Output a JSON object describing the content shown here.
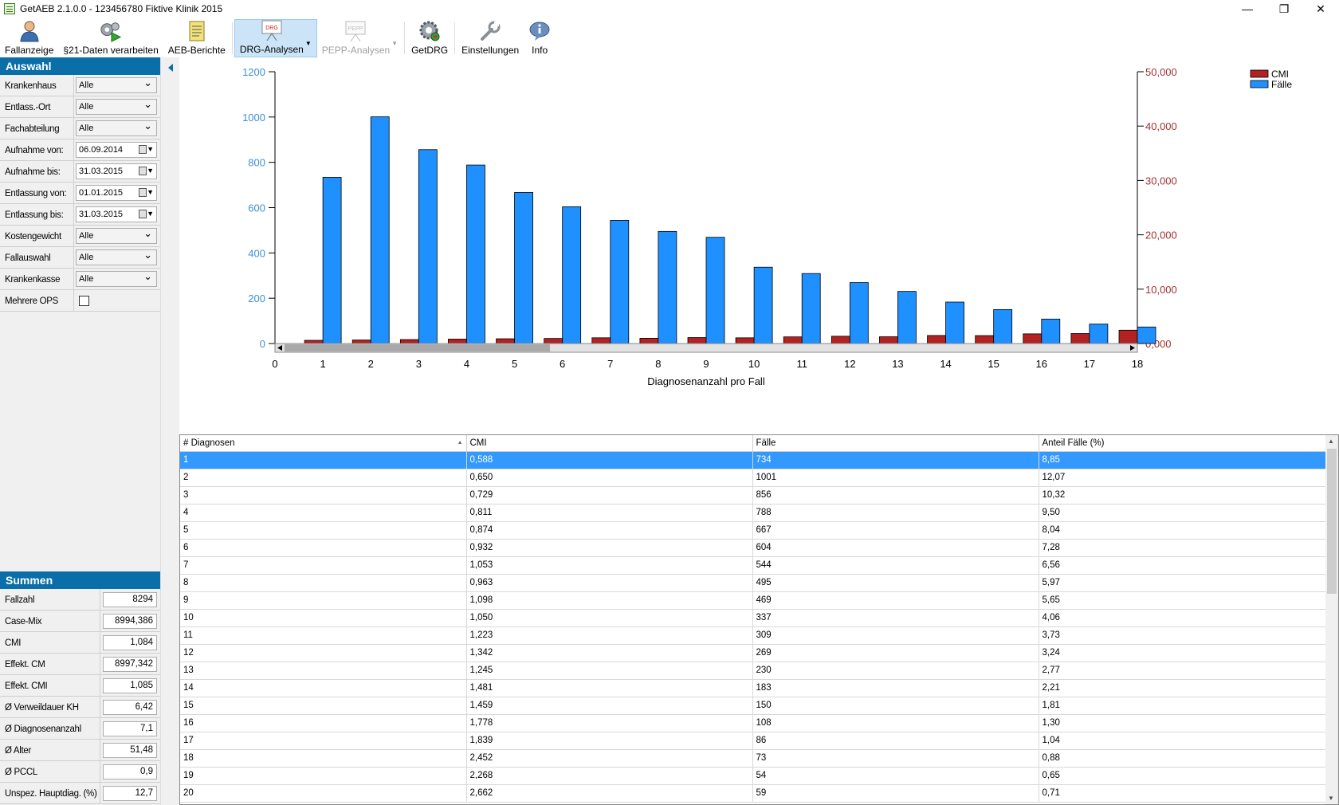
{
  "window": {
    "title": "GetAEB 2.1.0.0 - 123456780 Fiktive Klinik 2015",
    "minimize": "—",
    "restore": "❐",
    "close": "✕"
  },
  "toolbar": {
    "fallanzeige": "Fallanzeige",
    "p21": "§21-Daten verarbeiten",
    "aeb": "AEB-Berichte",
    "drg": "DRG-Analysen",
    "pepp": "PEPP-Analysen",
    "getdrg": "GetDRG",
    "einstellungen": "Einstellungen",
    "info": "Info",
    "drg_icon_text": "DRG",
    "pepp_icon_text": "PEPP"
  },
  "auswahl": {
    "title": "Auswahl",
    "rows": [
      {
        "label": "Krankenhaus",
        "value": "Alle"
      },
      {
        "label": "Entlass.-Ort",
        "value": "Alle"
      },
      {
        "label": "Fachabteilung",
        "value": "Alle"
      },
      {
        "label": "Aufnahme von:",
        "value": "06.09.2014"
      },
      {
        "label": "Aufnahme bis:",
        "value": "31.03.2015"
      },
      {
        "label": "Entlassung von:",
        "value": "01.01.2015"
      },
      {
        "label": "Entlassung bis:",
        "value": "31.03.2015"
      },
      {
        "label": "Kostengewicht",
        "value": "Alle"
      },
      {
        "label": "Fallauswahl",
        "value": "Alle"
      },
      {
        "label": "Krankenkasse",
        "value": "Alle"
      },
      {
        "label": "Mehrere OPS",
        "value": ""
      }
    ]
  },
  "summen": {
    "title": "Summen",
    "rows": [
      {
        "label": "Fallzahl",
        "value": "8294"
      },
      {
        "label": "Case-Mix",
        "value": "8994,386"
      },
      {
        "label": "CMI",
        "value": "1,084"
      },
      {
        "label": "Effekt. CM",
        "value": "8997,342"
      },
      {
        "label": "Effekt. CMI",
        "value": "1,085"
      },
      {
        "label": "Ø Verweildauer KH",
        "value": "6,42"
      },
      {
        "label": "Ø Diagnosenanzahl",
        "value": "7,1"
      },
      {
        "label": "Ø Alter",
        "value": "51,48"
      },
      {
        "label": "Ø PCCL",
        "value": "0,9"
      },
      {
        "label": "Unspez. Hauptdiag. (%)",
        "value": "12,7"
      }
    ]
  },
  "chart_data": {
    "type": "bar",
    "xlabel": "Diagnosenanzahl pro Fall",
    "x_ticks": [
      "0",
      "1",
      "2",
      "3",
      "4",
      "5",
      "6",
      "7",
      "8",
      "9",
      "10",
      "11",
      "12",
      "13",
      "14",
      "15",
      "16",
      "17",
      "18"
    ],
    "categories": [
      1,
      2,
      3,
      4,
      5,
      6,
      7,
      8,
      9,
      10,
      11,
      12,
      13,
      14,
      15,
      16,
      17,
      18
    ],
    "y_left_ticks": [
      "1200",
      "1000",
      "800",
      "600",
      "400",
      "200",
      "0"
    ],
    "y_left_range": [
      0,
      1200
    ],
    "y_right_ticks": [
      "50,000",
      "40,000",
      "30,000",
      "20,000",
      "10,000",
      "0,000"
    ],
    "y_right_range": [
      0,
      50
    ],
    "legend": [
      "CMI",
      "Fälle"
    ],
    "legend_position": "top-right",
    "colors": {
      "cmi": "#b22222",
      "faelle": "#1e90ff",
      "left_axis": "#3b8fd4",
      "right_axis": "#a33030"
    },
    "series": [
      {
        "name": "CMI",
        "axis": "right",
        "values": [
          0.588,
          0.65,
          0.729,
          0.811,
          0.874,
          0.932,
          1.053,
          0.963,
          1.098,
          1.05,
          1.223,
          1.342,
          1.245,
          1.481,
          1.459,
          1.778,
          1.839,
          2.452
        ]
      },
      {
        "name": "Fälle",
        "axis": "left",
        "values": [
          734,
          1001,
          856,
          788,
          667,
          604,
          544,
          495,
          469,
          337,
          309,
          269,
          230,
          183,
          150,
          108,
          86,
          73
        ]
      }
    ]
  },
  "table": {
    "columns": [
      "# Diagnosen",
      "CMI",
      "Fälle",
      "Anteil Fälle (%)"
    ],
    "rows": [
      [
        "1",
        "0,588",
        "734",
        "8,85"
      ],
      [
        "2",
        "0,650",
        "1001",
        "12,07"
      ],
      [
        "3",
        "0,729",
        "856",
        "10,32"
      ],
      [
        "4",
        "0,811",
        "788",
        "9,50"
      ],
      [
        "5",
        "0,874",
        "667",
        "8,04"
      ],
      [
        "6",
        "0,932",
        "604",
        "7,28"
      ],
      [
        "7",
        "1,053",
        "544",
        "6,56"
      ],
      [
        "8",
        "0,963",
        "495",
        "5,97"
      ],
      [
        "9",
        "1,098",
        "469",
        "5,65"
      ],
      [
        "10",
        "1,050",
        "337",
        "4,06"
      ],
      [
        "11",
        "1,223",
        "309",
        "3,73"
      ],
      [
        "12",
        "1,342",
        "269",
        "3,24"
      ],
      [
        "13",
        "1,245",
        "230",
        "2,77"
      ],
      [
        "14",
        "1,481",
        "183",
        "2,21"
      ],
      [
        "15",
        "1,459",
        "150",
        "1,81"
      ],
      [
        "16",
        "1,778",
        "108",
        "1,30"
      ],
      [
        "17",
        "1,839",
        "86",
        "1,04"
      ],
      [
        "18",
        "2,452",
        "73",
        "0,88"
      ],
      [
        "19",
        "2,268",
        "54",
        "0,65"
      ],
      [
        "20",
        "2,662",
        "59",
        "0,71"
      ]
    ]
  }
}
